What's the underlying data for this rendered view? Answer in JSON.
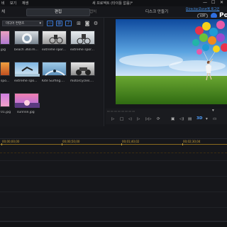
{
  "menubar": {
    "items": [
      "비",
      "보기",
      "재생"
    ],
    "title": "새 프로젝트 (타이틀 없음)*",
    "controls": [
      "—",
      "☐",
      "✕"
    ]
  },
  "topbar": {
    "tabs": [
      "체",
      "편집",
      "캡처",
      "디스크 만들기"
    ],
    "directorzone": "DirectorZone에 로그인",
    "app_badge": "APP",
    "brand": "Po"
  },
  "library": {
    "dropdown": "미디어 컨텐츠",
    "rows": [
      [
        "jpg",
        "beach 360.m...",
        "extreme spor...",
        "extreme spor..."
      ],
      [
        "spo...",
        "extreme spo...",
        "Kite Surfing....",
        "motorcycles...."
      ],
      [
        "01.jpg",
        "sunrise.jpg"
      ]
    ]
  },
  "preview": {
    "speed_label": "3D"
  },
  "timeline": {
    "marks": [
      "00;00;00;00",
      "00;00;50;00",
      "00;01;40;02",
      "00;02;30;04"
    ]
  },
  "colors": {
    "accent": "#3a7ad8",
    "timeline": "#c9a23a",
    "brand": "#2f6fe0"
  }
}
